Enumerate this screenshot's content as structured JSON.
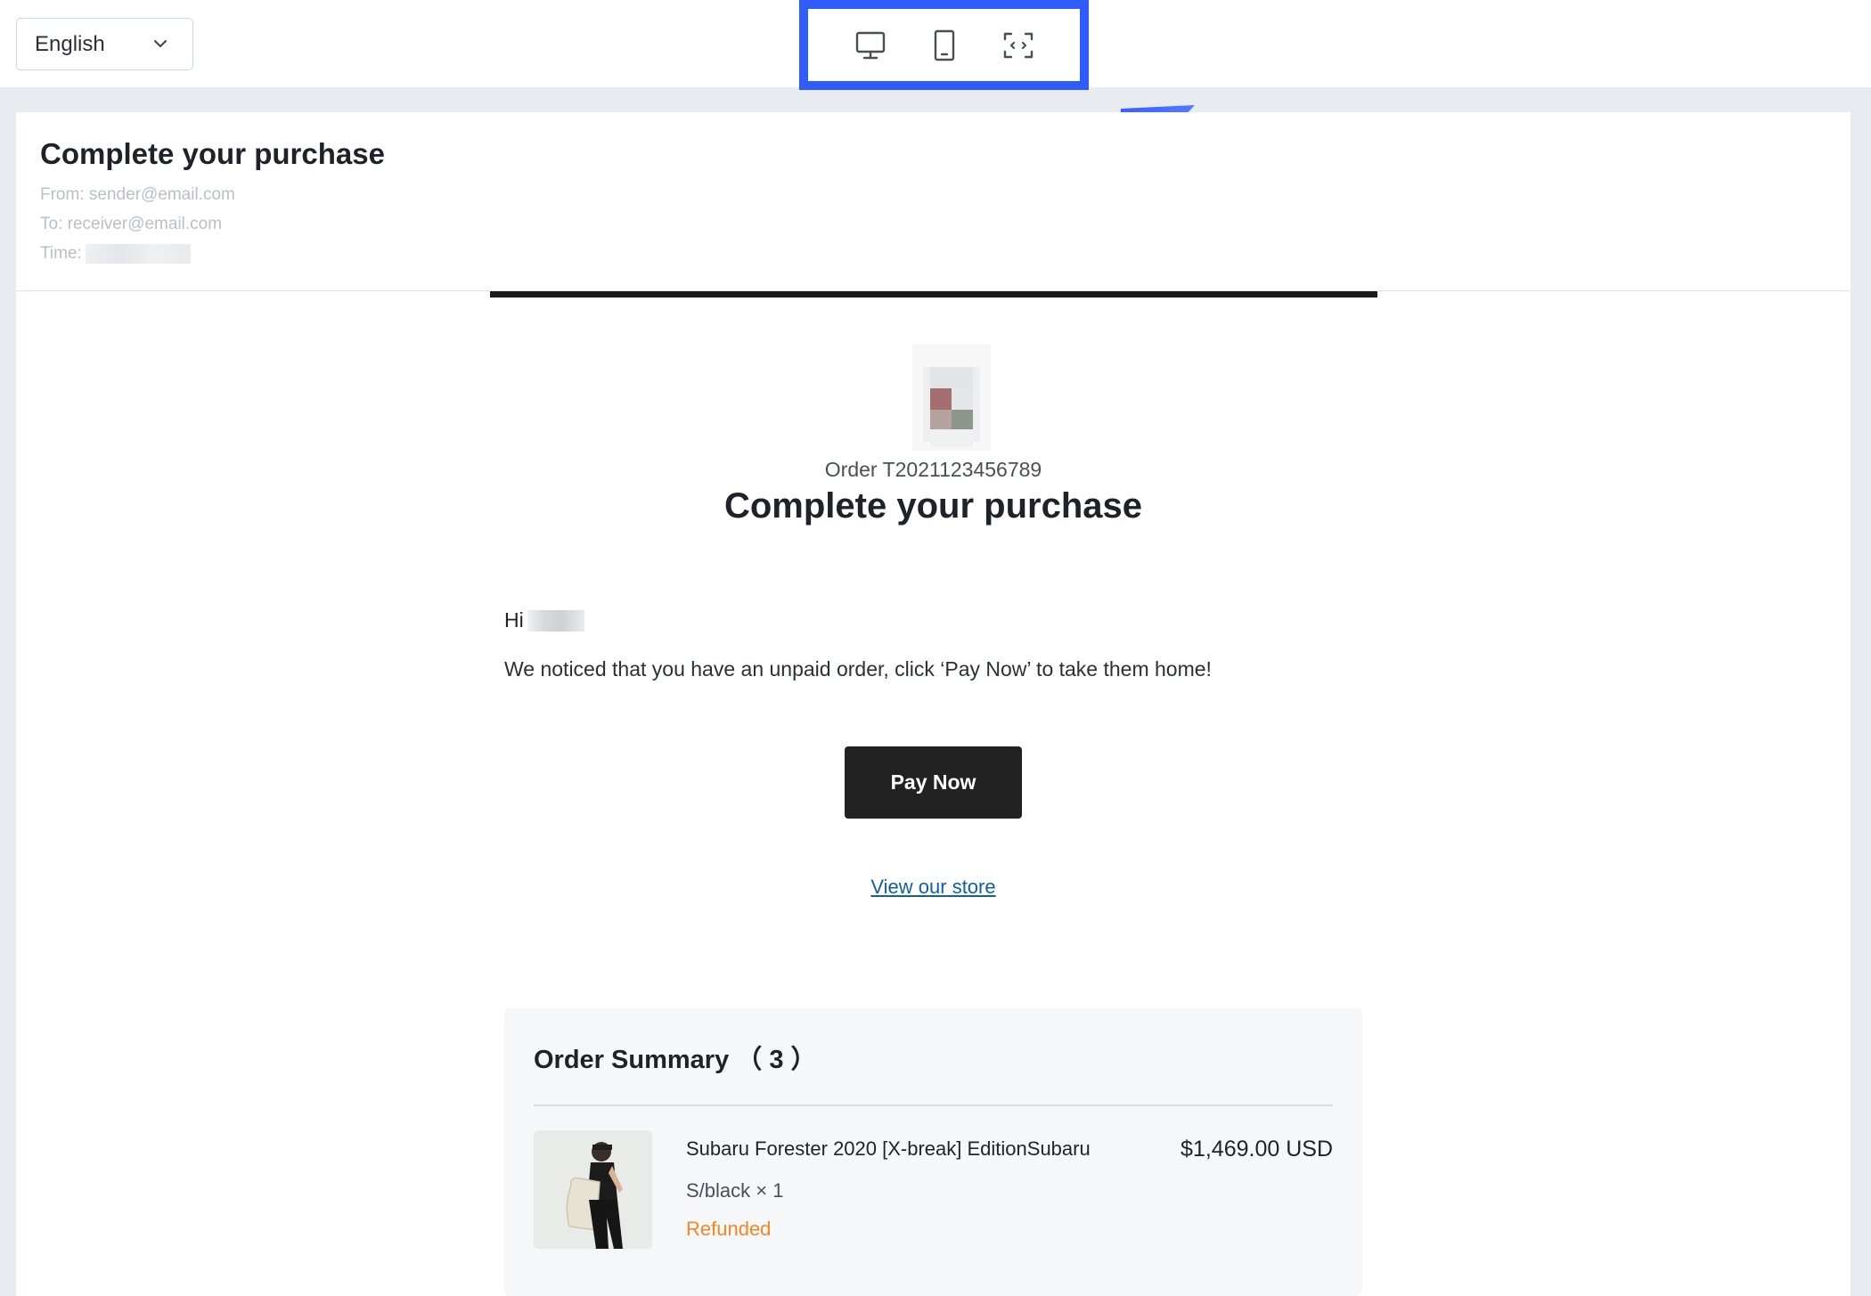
{
  "toolbar": {
    "language": "English",
    "device_buttons": [
      "desktop-icon",
      "tablet-icon",
      "fullscreen-icon"
    ],
    "highlight_color": "#2f5cff"
  },
  "email": {
    "subject": "Complete your purchase",
    "from": "From: sender@email.com",
    "to": "To: receiver@email.com",
    "time_label": "Time:",
    "order_number": "Order T2021123456789",
    "title": "Complete your purchase",
    "greeting": "Hi",
    "message": "We noticed that you have an unpaid order, click ‘Pay Now’ to take them home!",
    "pay_button": "Pay Now",
    "store_link": "View our store"
  },
  "summary": {
    "title": "Order Summary （ 3 ）",
    "items": [
      {
        "name": "Subaru Forester 2020 [X-break] EditionSubaru",
        "variant": "S/black × 1",
        "status": "Refunded",
        "price": "$1,469.00 USD"
      }
    ]
  },
  "colors": {
    "accent": "#2f5cff",
    "button_bg": "#222222",
    "link": "#0f5fa8",
    "status_refunded": "#f5861f"
  }
}
